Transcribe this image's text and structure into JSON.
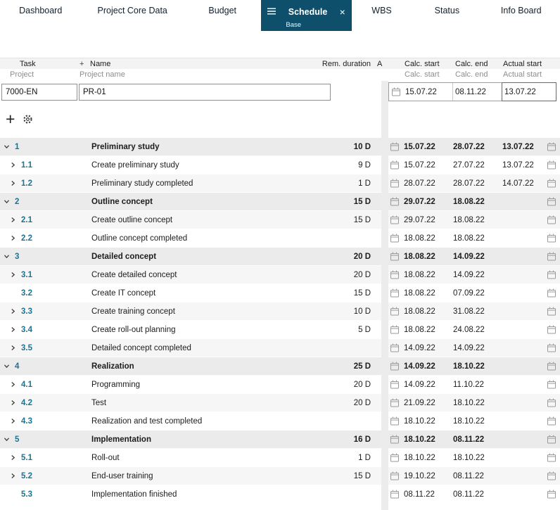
{
  "tabs": [
    {
      "label": "Dashboard"
    },
    {
      "label": "Project Core Data"
    },
    {
      "label": "Budget"
    },
    {
      "label": "Schedule",
      "active": true,
      "sublabel": "Base",
      "close_label": "×"
    },
    {
      "label": "WBS"
    },
    {
      "label": "Status"
    },
    {
      "label": "Info Board"
    }
  ],
  "header": {
    "task": "Task",
    "plus": "+",
    "name": "Name",
    "rem_duration": "Rem. duration",
    "a_clipped": "A",
    "project": "Project",
    "project_name": "Project name",
    "calc_start": "Calc. start",
    "calc_end": "Calc. end",
    "actual_start": "Actual start"
  },
  "project_row": {
    "id": "7000-EN",
    "name": "PR-01",
    "calc_start": "15.07.22",
    "calc_end": "08.11.22",
    "actual_start": "13.07.22"
  },
  "toolbar": {
    "add_label": "+",
    "settings_icon": "gear-icon"
  },
  "colors": {
    "active_tab": "#0e506b",
    "task_number": "#1b7392"
  },
  "rows": [
    {
      "num": "1",
      "name": "Preliminary study",
      "duration": "10 D",
      "calc_start": "15.07.22",
      "calc_end": "28.07.22",
      "actual_start": "13.07.22",
      "level": 0,
      "expander": "down",
      "bold": true,
      "stripe": "parent"
    },
    {
      "num": "1.1",
      "name": "Create preliminary study",
      "duration": "9 D",
      "calc_start": "15.07.22",
      "calc_end": "27.07.22",
      "actual_start": "13.07.22",
      "level": 1,
      "expander": "right",
      "bold": false,
      "stripe": "white"
    },
    {
      "num": "1.2",
      "name": "Preliminary study completed",
      "duration": "1 D",
      "calc_start": "28.07.22",
      "calc_end": "28.07.22",
      "actual_start": "14.07.22",
      "level": 1,
      "expander": "right",
      "bold": false,
      "stripe": "light"
    },
    {
      "num": "2",
      "name": "Outline concept",
      "duration": "15 D",
      "calc_start": "29.07.22",
      "calc_end": "18.08.22",
      "actual_start": "",
      "level": 0,
      "expander": "down",
      "bold": true,
      "stripe": "parent"
    },
    {
      "num": "2.1",
      "name": "Create outline concept",
      "duration": "15 D",
      "calc_start": "29.07.22",
      "calc_end": "18.08.22",
      "actual_start": "",
      "level": 1,
      "expander": "right",
      "bold": false,
      "stripe": "light"
    },
    {
      "num": "2.2",
      "name": "Outline concept completed",
      "duration": "",
      "calc_start": "18.08.22",
      "calc_end": "18.08.22",
      "actual_start": "",
      "level": 1,
      "expander": "right",
      "bold": false,
      "stripe": "white"
    },
    {
      "num": "3",
      "name": "Detailed concept",
      "duration": "20 D",
      "calc_start": "18.08.22",
      "calc_end": "14.09.22",
      "actual_start": "",
      "level": 0,
      "expander": "down",
      "bold": true,
      "stripe": "parent"
    },
    {
      "num": "3.1",
      "name": "Create detailed concept",
      "duration": "20 D",
      "calc_start": "18.08.22",
      "calc_end": "14.09.22",
      "actual_start": "",
      "level": 1,
      "expander": "right",
      "bold": false,
      "stripe": "light"
    },
    {
      "num": "3.2",
      "name": "Create IT concept",
      "duration": "15 D",
      "calc_start": "18.08.22",
      "calc_end": "07.09.22",
      "actual_start": "",
      "level": 1,
      "expander": "none",
      "bold": false,
      "stripe": "white"
    },
    {
      "num": "3.3",
      "name": "Create training concept",
      "duration": "10 D",
      "calc_start": "18.08.22",
      "calc_end": "31.08.22",
      "actual_start": "",
      "level": 1,
      "expander": "right",
      "bold": false,
      "stripe": "light"
    },
    {
      "num": "3.4",
      "name": "Create roll-out planning",
      "duration": "5 D",
      "calc_start": "18.08.22",
      "calc_end": "24.08.22",
      "actual_start": "",
      "level": 1,
      "expander": "right",
      "bold": false,
      "stripe": "white"
    },
    {
      "num": "3.5",
      "name": "Detailed concept completed",
      "duration": "",
      "calc_start": "14.09.22",
      "calc_end": "14.09.22",
      "actual_start": "",
      "level": 1,
      "expander": "right",
      "bold": false,
      "stripe": "light"
    },
    {
      "num": "4",
      "name": "Realization",
      "duration": "25 D",
      "calc_start": "14.09.22",
      "calc_end": "18.10.22",
      "actual_start": "",
      "level": 0,
      "expander": "down",
      "bold": true,
      "stripe": "parent"
    },
    {
      "num": "4.1",
      "name": "Programming",
      "duration": "20 D",
      "calc_start": "14.09.22",
      "calc_end": "11.10.22",
      "actual_start": "",
      "level": 1,
      "expander": "right",
      "bold": false,
      "stripe": "white"
    },
    {
      "num": "4.2",
      "name": "Test",
      "duration": "20 D",
      "calc_start": "21.09.22",
      "calc_end": "18.10.22",
      "actual_start": "",
      "level": 1,
      "expander": "right",
      "bold": false,
      "stripe": "light"
    },
    {
      "num": "4.3",
      "name": "Realization and test completed",
      "duration": "",
      "calc_start": "18.10.22",
      "calc_end": "18.10.22",
      "actual_start": "",
      "level": 1,
      "expander": "right",
      "bold": false,
      "stripe": "white"
    },
    {
      "num": "5",
      "name": "Implementation",
      "duration": "16 D",
      "calc_start": "18.10.22",
      "calc_end": "08.11.22",
      "actual_start": "",
      "level": 0,
      "expander": "down",
      "bold": true,
      "stripe": "parent"
    },
    {
      "num": "5.1",
      "name": "Roll-out",
      "duration": "1 D",
      "calc_start": "18.10.22",
      "calc_end": "18.10.22",
      "actual_start": "",
      "level": 1,
      "expander": "right",
      "bold": false,
      "stripe": "white"
    },
    {
      "num": "5.2",
      "name": "End-user training",
      "duration": "15 D",
      "calc_start": "19.10.22",
      "calc_end": "08.11.22",
      "actual_start": "",
      "level": 1,
      "expander": "right",
      "bold": false,
      "stripe": "light"
    },
    {
      "num": "5.3",
      "name": "Implementation finished",
      "duration": "",
      "calc_start": "08.11.22",
      "calc_end": "08.11.22",
      "actual_start": "",
      "level": 1,
      "expander": "none",
      "bold": false,
      "stripe": "white"
    }
  ]
}
